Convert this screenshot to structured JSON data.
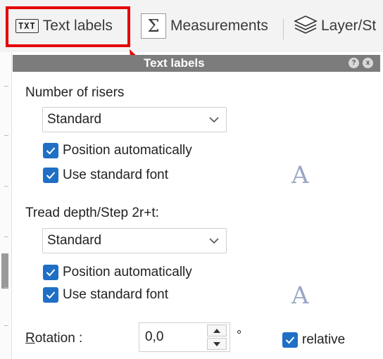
{
  "toolbar": {
    "tabs": [
      {
        "label": "Text labels",
        "icon": "txt-icon",
        "icon_text": "TXT"
      },
      {
        "label": "Measurements",
        "icon": "sigma-icon",
        "icon_text": "Σ"
      },
      {
        "label": "Layer/St",
        "icon": "layers-icon"
      }
    ]
  },
  "panel": {
    "title": "Text labels",
    "help_glyph": "?",
    "close_glyph": "x"
  },
  "risers": {
    "heading": "Number of risers",
    "select_value": "Standard",
    "position_auto_label": "Position automatically",
    "position_auto_checked": true,
    "std_font_label": "Use standard font",
    "std_font_checked": true,
    "font_glyph": "A"
  },
  "tread": {
    "heading": "Tread depth/Step 2r+t:",
    "select_value": "Standard",
    "position_auto_label": "Position automatically",
    "position_auto_checked": true,
    "std_font_label": "Use standard font",
    "std_font_checked": true,
    "font_glyph": "A"
  },
  "rotation": {
    "label_underlined": "R",
    "label_rest": "otation :",
    "value": "0,0",
    "unit": "°",
    "relative_label": "relative",
    "relative_checked": true
  },
  "colors": {
    "highlight": "#e60000",
    "checkbox": "#1f6fc5",
    "header": "#7c7c7c"
  }
}
